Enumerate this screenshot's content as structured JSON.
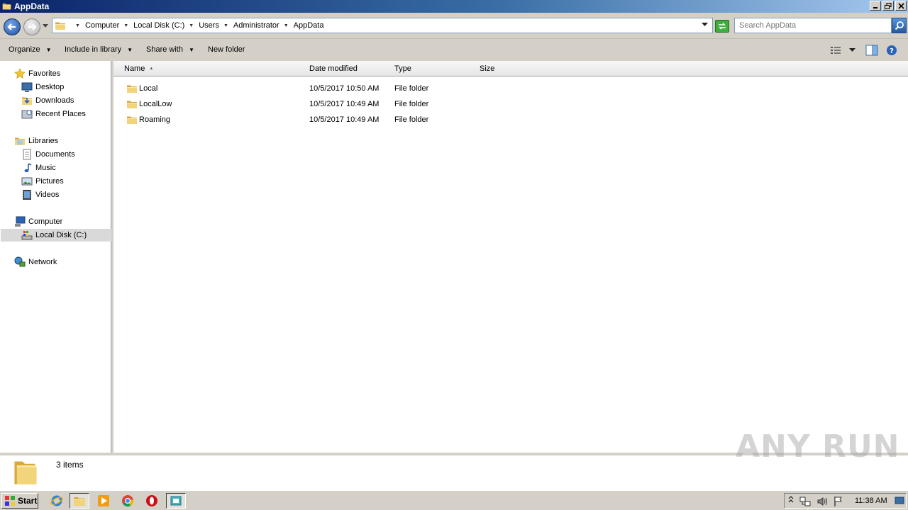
{
  "window": {
    "title": "AppData"
  },
  "address": {
    "crumbs": [
      "Computer",
      "Local Disk (C:)",
      "Users",
      "Administrator",
      "AppData"
    ]
  },
  "search": {
    "placeholder": "Search AppData"
  },
  "commands": {
    "organize": "Organize",
    "include_in_library": "Include in library",
    "share_with": "Share with",
    "new_folder": "New folder"
  },
  "nav": {
    "favorites": {
      "label": "Favorites",
      "items": [
        "Desktop",
        "Downloads",
        "Recent Places"
      ]
    },
    "libraries": {
      "label": "Libraries",
      "items": [
        "Documents",
        "Music",
        "Pictures",
        "Videos"
      ]
    },
    "computer": {
      "label": "Computer",
      "items": [
        "Local Disk (C:)"
      ]
    },
    "network": {
      "label": "Network"
    }
  },
  "columns": {
    "name": "Name",
    "date_modified": "Date modified",
    "type": "Type",
    "size": "Size"
  },
  "files": [
    {
      "name": "Local",
      "date": "10/5/2017 10:50 AM",
      "type": "File folder",
      "size": ""
    },
    {
      "name": "LocalLow",
      "date": "10/5/2017 10:49 AM",
      "type": "File folder",
      "size": ""
    },
    {
      "name": "Roaming",
      "date": "10/5/2017 10:49 AM",
      "type": "File folder",
      "size": ""
    }
  ],
  "status": {
    "count": "3 items"
  },
  "watermark": "ANY RUN",
  "taskbar": {
    "start": "Start",
    "clock": "11:38 AM"
  },
  "colors": {
    "folder": "#e8c65a",
    "accent": "#1d4fa0",
    "chrome": "#d4d0c8"
  },
  "icons": [
    "folder-icon",
    "back-arrow-icon",
    "forward-arrow-icon",
    "search-icon",
    "refresh-icon",
    "star-icon",
    "desktop-icon",
    "downloads-icon",
    "recent-places-icon",
    "library-icon",
    "documents-icon",
    "music-icon",
    "pictures-icon",
    "videos-icon",
    "computer-icon",
    "drive-icon",
    "network-icon",
    "help-icon",
    "view-icon",
    "preview-pane-icon",
    "ie-icon",
    "explorer-icon",
    "media-player-icon",
    "chrome-icon",
    "opera-icon",
    "app-icon",
    "flag-icon",
    "speaker-icon"
  ]
}
